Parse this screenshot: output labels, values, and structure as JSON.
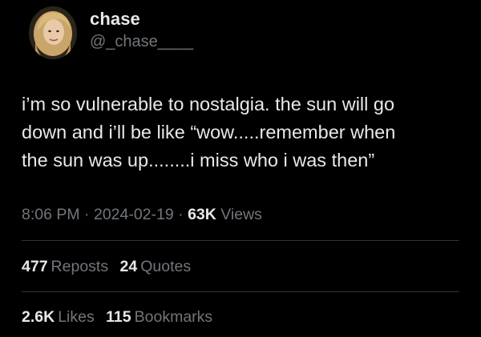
{
  "author": {
    "display_name": "chase",
    "handle": "@_chase____",
    "avatar_icon": "profile-photo"
  },
  "tweet": {
    "lines": [
      "i’m so vulnerable to nostalgia. the sun will go",
      "down and i’ll be like “wow.....remember when",
      "the sun was up........i miss who i was then”"
    ]
  },
  "meta": {
    "time": "8:06 PM",
    "separator": "·",
    "date": "2024-02-19",
    "views_count": "63K",
    "views_label": "Views"
  },
  "stats": {
    "reposts_count": "477",
    "reposts_label": "Reposts",
    "quotes_count": "24",
    "quotes_label": "Quotes",
    "likes_count": "2.6K",
    "likes_label": "Likes",
    "bookmarks_count": "115",
    "bookmarks_label": "Bookmarks"
  },
  "colors": {
    "background": "#000000",
    "primary_text": "#e7e9ea",
    "secondary_text": "#71767b",
    "divider": "#2f3336"
  }
}
